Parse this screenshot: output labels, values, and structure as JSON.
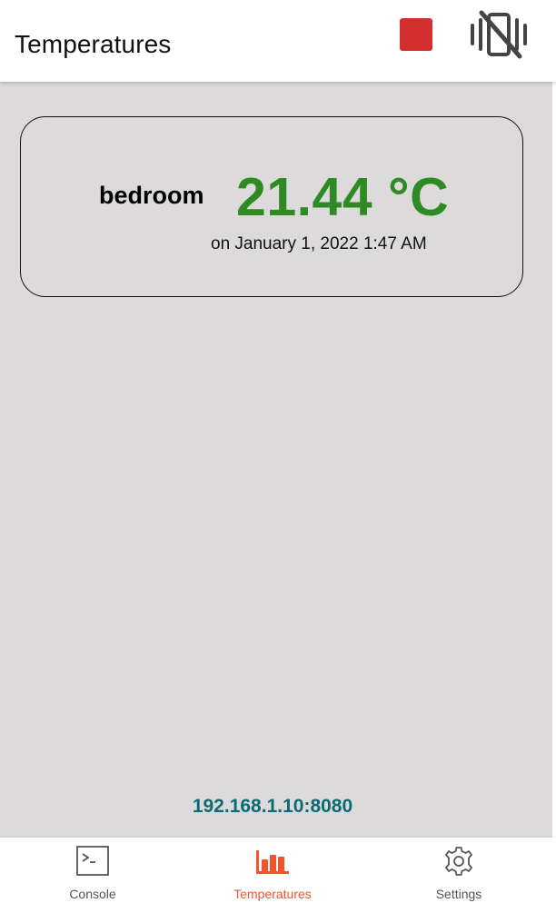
{
  "app_bar": {
    "title": "Temperatures",
    "stop_color": "#d32f2f",
    "vibrate_icon": "vibrate-off-icon"
  },
  "reading": {
    "sensor": "bedroom",
    "temperature": "21.44 °C",
    "timestamp": "on January 1, 2022 1:47 AM",
    "temperature_color": "#2e8b24"
  },
  "server_address": "192.168.1.10:8080",
  "bottom_nav": {
    "items": [
      {
        "label": "Console",
        "icon": "terminal-icon",
        "active": false
      },
      {
        "label": "Temperatures",
        "icon": "bar-chart-icon",
        "active": true
      },
      {
        "label": "Settings",
        "icon": "gear-icon",
        "active": false
      }
    ],
    "active_color": "#f0552e"
  }
}
